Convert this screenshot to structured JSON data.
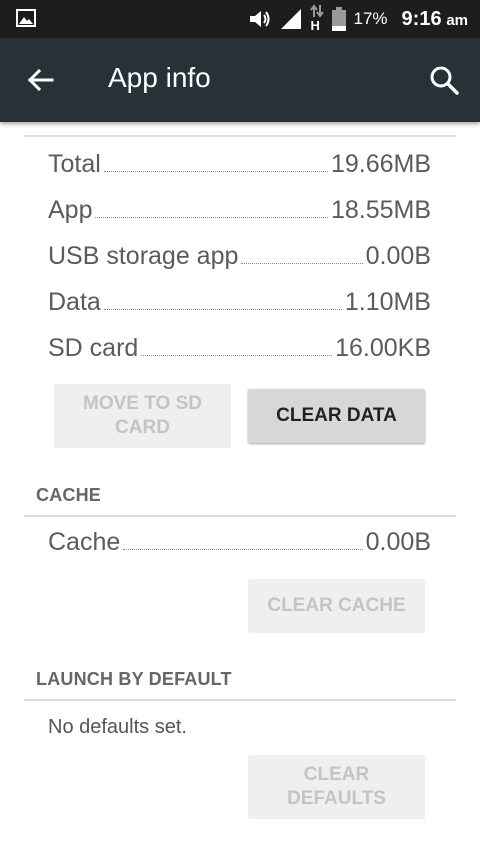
{
  "status_bar": {
    "battery_percent": "17%",
    "time": "9:16",
    "ampm": "am",
    "network_type": "H",
    "icons": [
      "image-notification-icon",
      "volume-icon",
      "signal-icon",
      "data-arrows-icon",
      "battery-icon"
    ]
  },
  "app_bar": {
    "title": "App info",
    "icons": [
      "back-arrow-icon",
      "search-icon"
    ]
  },
  "storage": {
    "rows": [
      {
        "label": "Total",
        "value": "19.66MB"
      },
      {
        "label": "App",
        "value": "18.55MB"
      },
      {
        "label": "USB storage app",
        "value": "0.00B"
      },
      {
        "label": "Data",
        "value": "1.10MB"
      },
      {
        "label": "SD card",
        "value": "16.00KB"
      }
    ],
    "move_button_line1": "MOVE TO SD",
    "move_button_line2": "CARD",
    "clear_data_button": "CLEAR DATA"
  },
  "cache": {
    "header": "CACHE",
    "row": {
      "label": "Cache",
      "value": "0.00B"
    },
    "clear_cache_button": "CLEAR CACHE"
  },
  "launch": {
    "header": "LAUNCH BY DEFAULT",
    "text": "No defaults set.",
    "clear_defaults_line1": "CLEAR",
    "clear_defaults_line2": "DEFAULTS"
  },
  "colors": {
    "status_bar": "#1d1d1d",
    "app_bar": "#263238",
    "divider": "#dcdcdc",
    "button_enabled": "#d7d7d7",
    "button_disabled": "#efefef"
  }
}
